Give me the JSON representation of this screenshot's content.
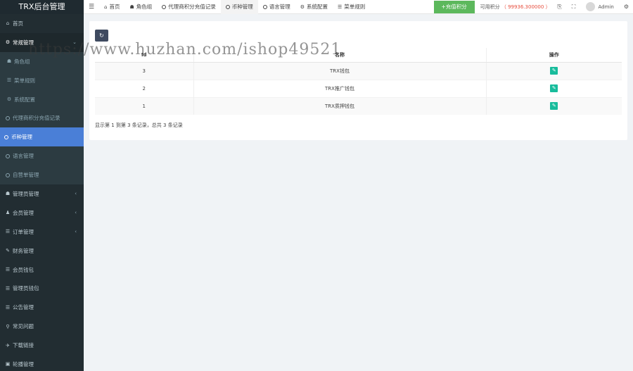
{
  "sidebar": {
    "logo": "TRX后台管理",
    "items": [
      {
        "label": "首页",
        "icon": "dashboard-icon",
        "glyph": "⌂",
        "kind": "top"
      },
      {
        "label": "常规管理",
        "icon": "cogs-icon",
        "glyph": "⚙",
        "kind": "open",
        "chevron": "⌄"
      },
      {
        "label": "角色组",
        "icon": "group-icon",
        "glyph": "☗",
        "kind": "sub"
      },
      {
        "label": "菜单规则",
        "icon": "list-icon",
        "glyph": "☰",
        "kind": "sub"
      },
      {
        "label": "系统配置",
        "icon": "gear-icon",
        "glyph": "⚙",
        "kind": "sub"
      },
      {
        "label": "代理商积分充值记录",
        "icon": "circle-icon",
        "kind": "sub-circle"
      },
      {
        "label": "币种管理",
        "icon": "circle-icon",
        "kind": "active-circle"
      },
      {
        "label": "语言管理",
        "icon": "circle-icon",
        "kind": "sub-circle"
      },
      {
        "label": "自营单管理",
        "icon": "circle-icon",
        "kind": "sub-circle"
      },
      {
        "label": "管理员管理",
        "icon": "users-icon",
        "glyph": "☗",
        "kind": "top",
        "chevron": "‹"
      },
      {
        "label": "会员管理",
        "icon": "user-icon",
        "glyph": "♟",
        "kind": "top",
        "chevron": "‹"
      },
      {
        "label": "订单管理",
        "icon": "list-icon",
        "glyph": "☰",
        "kind": "top",
        "chevron": "‹"
      },
      {
        "label": "财务管理",
        "icon": "edit-icon",
        "glyph": "✎",
        "kind": "top"
      },
      {
        "label": "会员钱包",
        "icon": "list-icon",
        "glyph": "☰",
        "kind": "top"
      },
      {
        "label": "管理员钱包",
        "icon": "list-icon",
        "glyph": "☰",
        "kind": "top"
      },
      {
        "label": "公告管理",
        "icon": "list-icon",
        "glyph": "☰",
        "kind": "top"
      },
      {
        "label": "常见问题",
        "icon": "search-icon",
        "glyph": "⚲",
        "kind": "top"
      },
      {
        "label": "下载链接",
        "icon": "plane-icon",
        "glyph": "✈",
        "kind": "top"
      },
      {
        "label": "轮播管理",
        "icon": "image-icon",
        "glyph": "▣",
        "kind": "top"
      }
    ]
  },
  "header": {
    "menu_icon": "☰",
    "tabs": [
      {
        "label": "首页",
        "icon": "dashboard-icon",
        "glyph": "⌂",
        "active": false
      },
      {
        "label": "角色组",
        "icon": "group-icon",
        "glyph": "☗",
        "active": false
      },
      {
        "label": "代理商积分充值记录",
        "icon": "circle-icon",
        "circle": true,
        "active": false
      },
      {
        "label": "币种管理",
        "icon": "circle-icon",
        "circle": true,
        "active": true
      },
      {
        "label": "语言管理",
        "icon": "circle-icon",
        "circle": true,
        "active": false
      },
      {
        "label": "系统配置",
        "icon": "gear-icon",
        "glyph": "⚙",
        "active": false
      },
      {
        "label": "菜单规则",
        "icon": "list-icon",
        "glyph": "☰",
        "active": false
      }
    ],
    "recharge_label": "+充值积分",
    "points_label": "可用积分",
    "points_value": "（ 99936.300000 ）",
    "user_name": "Admin"
  },
  "table": {
    "headers": [
      "Id",
      "名称",
      "操作"
    ],
    "rows": [
      {
        "id": "3",
        "name": "TRX钱包"
      },
      {
        "id": "2",
        "name": "TRX推广钱包"
      },
      {
        "id": "1",
        "name": "TRX质押钱包"
      }
    ]
  },
  "pager": {
    "info": "显示第 1 到第 3 条记录，总共 3 条记录"
  },
  "watermark": "https://www.huzhan.com/ishop49521",
  "colors": {
    "sidebar_bg": "#222d32",
    "active_item": "#4a7fd7",
    "recharge_button": "#5cb85c",
    "edit_button": "#18bc9c",
    "points_value": "#e74c3c"
  }
}
